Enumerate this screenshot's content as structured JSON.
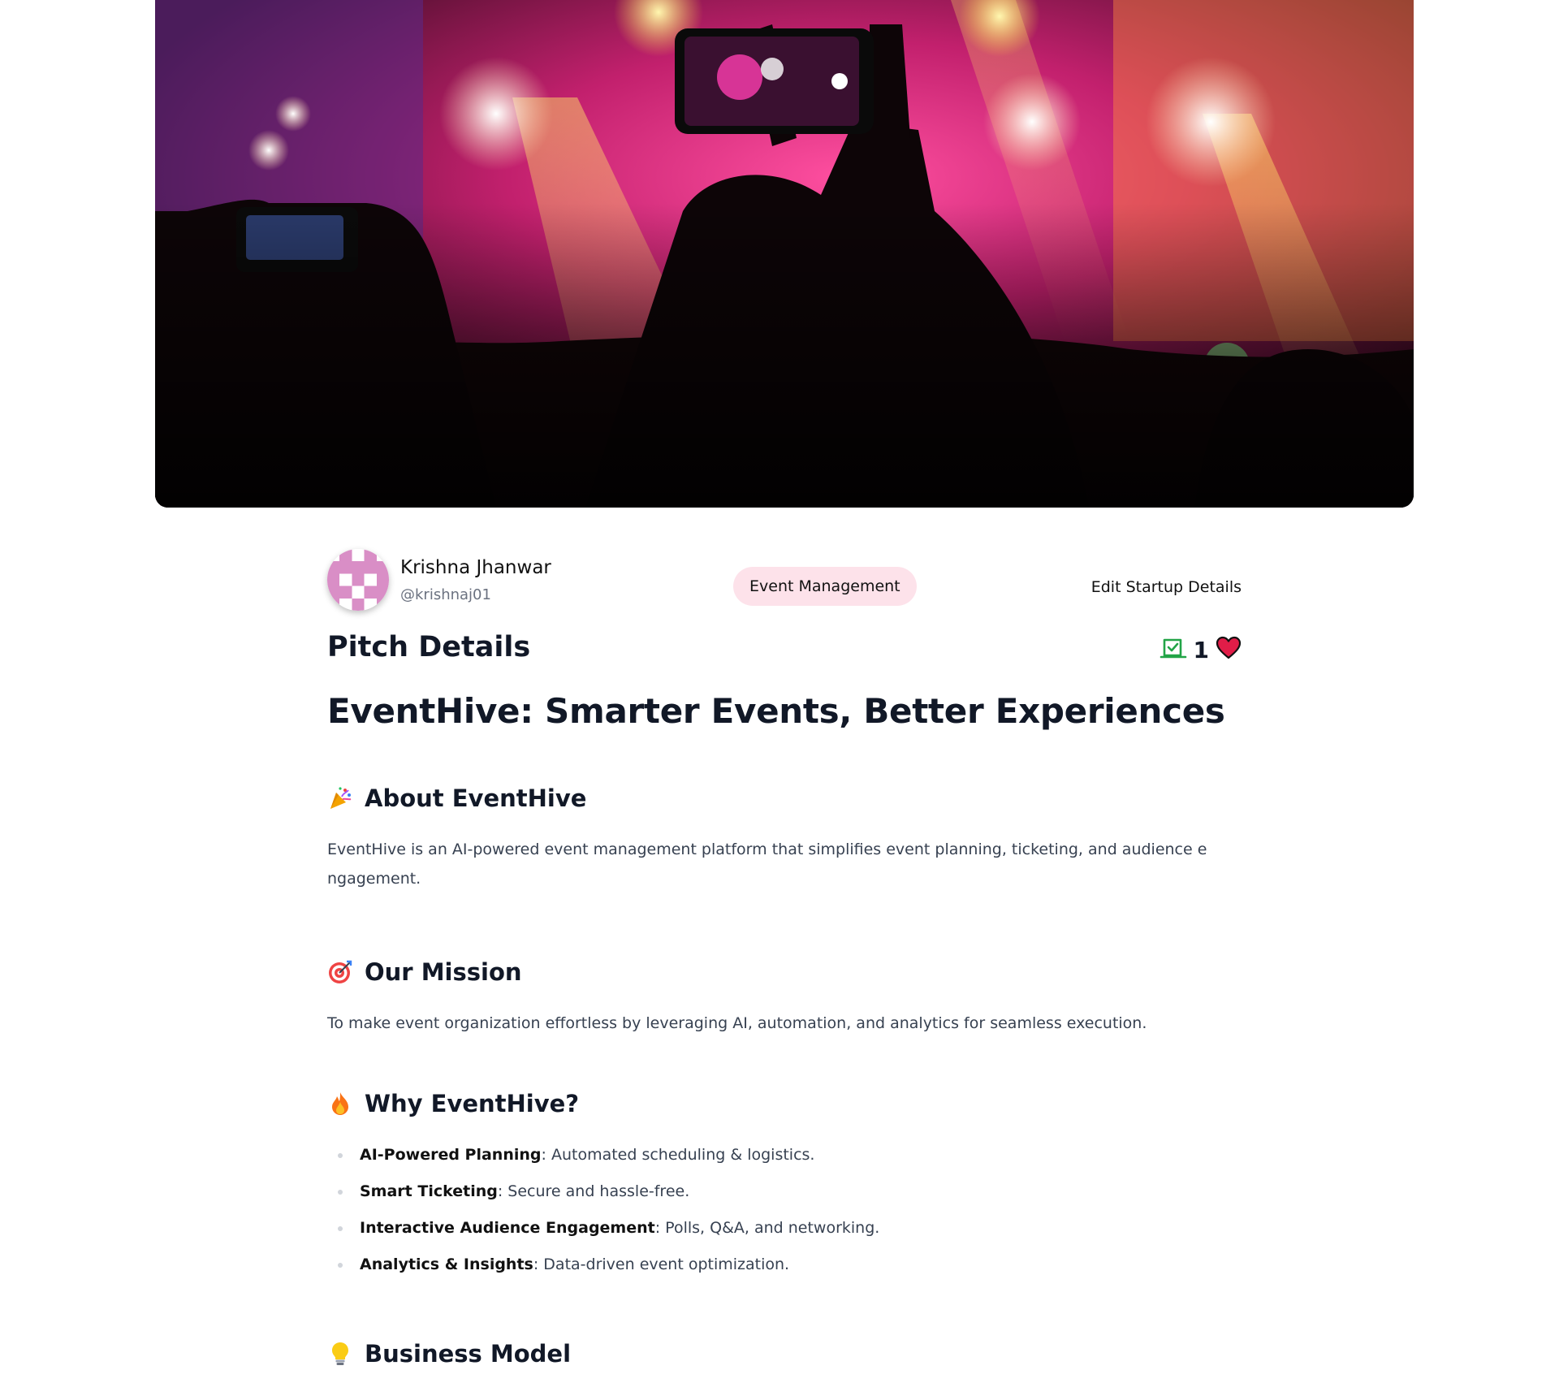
{
  "hero": {
    "image": "concert-crowd-phone-photo"
  },
  "author": {
    "name": "Krishna Jhanwar",
    "handle": "@krishnaj01",
    "avatar": "pixel-identicon-avatar",
    "avatar_color": "#d98ec6"
  },
  "category": {
    "label": "Event Management",
    "bg_color": "#fde2ea"
  },
  "edit_link": "Edit Startup Details",
  "pitch": {
    "heading": "Pitch Details",
    "approved_icon": "check-square-icon",
    "like_count": "1",
    "like_icon": "heart-icon",
    "approved_color": "#22a447",
    "heart_color": "#e11d48"
  },
  "startup_title": "EventHive: Smarter Events, Better Experiences",
  "sections": {
    "about": {
      "icon": "party-popper-emoji",
      "heading": "About EventHive",
      "text": "EventHive is an AI-powered event management platform that simplifies event planning, ticketing, and audience e ngagement."
    },
    "mission": {
      "icon": "target-emoji",
      "heading": "Our Mission",
      "text": "To make event organization effortless by leveraging AI, automation, and analytics for seamless execution."
    },
    "why": {
      "icon": "fire-emoji",
      "heading": "Why EventHive?",
      "features": [
        {
          "title": "AI-Powered Planning",
          "desc": ": Automated scheduling & logistics."
        },
        {
          "title": "Smart Ticketing",
          "desc": ": Secure and hassle-free."
        },
        {
          "title": "Interactive Audience Engagement",
          "desc": ": Polls, Q&A, and networking."
        },
        {
          "title": "Analytics & Insights",
          "desc": ": Data-driven event optimization."
        }
      ]
    },
    "business": {
      "icon": "light-bulb-emoji",
      "heading": "Business Model"
    }
  }
}
